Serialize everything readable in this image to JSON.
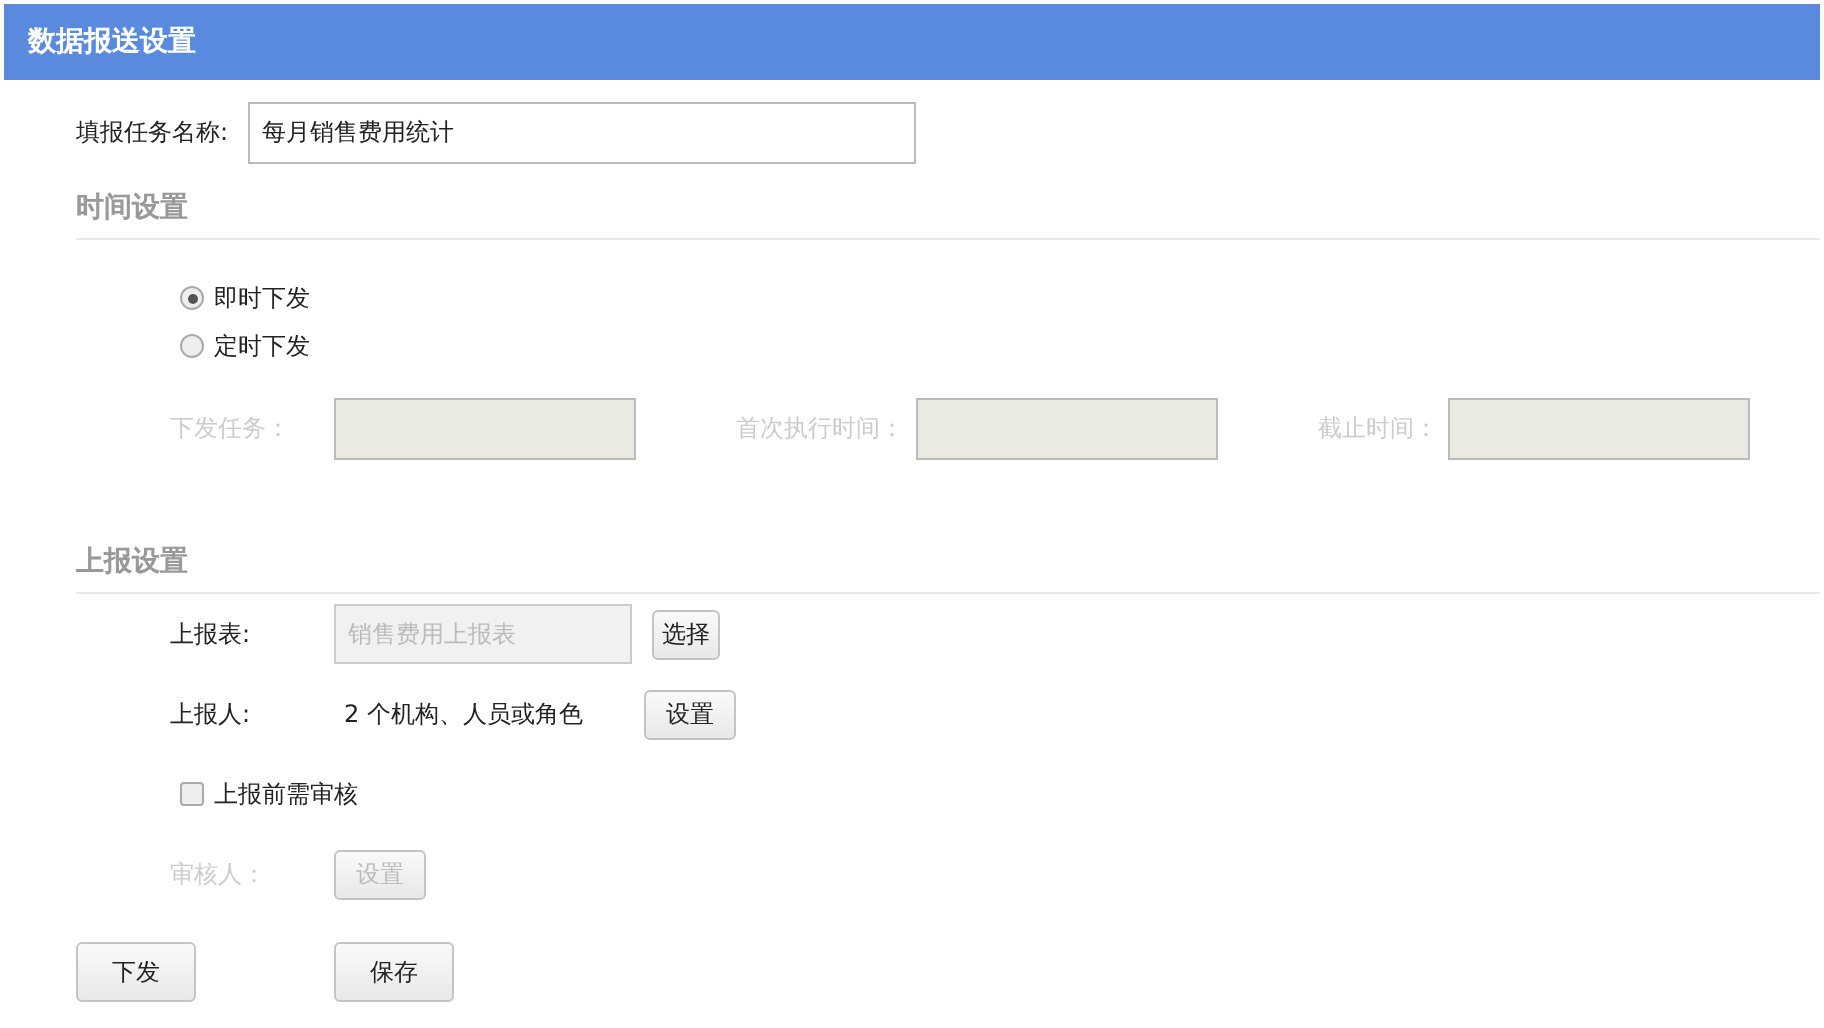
{
  "header": {
    "title": "数据报送设置"
  },
  "task_name": {
    "label": "填报任务名称:",
    "value": "每月销售费用统计"
  },
  "time_section": {
    "title": "时间设置",
    "modes": [
      {
        "label": "即时下发",
        "selected": true
      },
      {
        "label": "定时下发",
        "selected": false
      }
    ],
    "fields": [
      {
        "label": "下发任务：",
        "disabled": true
      },
      {
        "label": "首次执行时间：",
        "disabled": true
      },
      {
        "label": "截止时间：",
        "disabled": true
      }
    ]
  },
  "report_section": {
    "title": "上报设置",
    "form": {
      "label": "上报表:",
      "value": "销售费用上报表",
      "button": "选择"
    },
    "reporters": {
      "label": "上报人:",
      "text": "2 个机构、人员或角色",
      "button": "设置"
    },
    "review_required": {
      "label": "上报前需审核",
      "checked": false
    },
    "reviewer": {
      "label": "审核人：",
      "button": "设置",
      "disabled": true
    }
  },
  "actions": [
    {
      "label": "下发"
    },
    {
      "label": "保存"
    }
  ]
}
